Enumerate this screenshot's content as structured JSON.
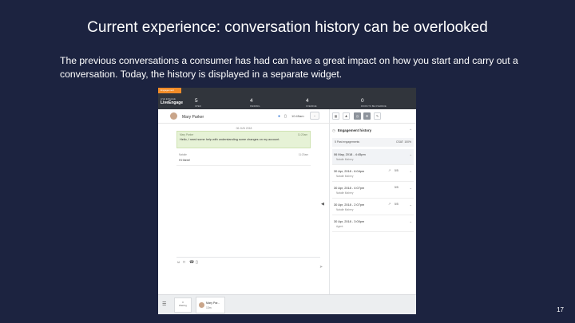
{
  "slide": {
    "title": "Current experience: conversation history can be overlooked",
    "body": "The previous conversations a consumer has had can have a great impact on how you start and carry out a conversation. Today, the history is displayed in a separate widget.",
    "page_number": "17"
  },
  "app": {
    "top_tab": "Engagement",
    "logo_sub": "LIVE ENGAGE",
    "logo_name": "LiveEngage",
    "stats": [
      {
        "num": "5",
        "label": "OPEN"
      },
      {
        "num": "4",
        "label": "PENDING"
      },
      {
        "num": "4",
        "label": "OVERDUE"
      },
      {
        "num": "0",
        "label": "ROOM TO BE OVERDUE"
      }
    ]
  },
  "chat": {
    "contact_name": "Mary Parker",
    "header_time": "10:45am",
    "date_separator": "06 JUN 2018",
    "messages": [
      {
        "sender": "Mary Parker",
        "time": "11:20am",
        "text": "Hello, I need some help with understanding some changes on my account.",
        "type": "consumer"
      },
      {
        "sender": "Natalie",
        "time": "11:20am",
        "text": "Hi there!",
        "type": "agent"
      }
    ]
  },
  "bottom": {
    "waiting_label": "Waiting",
    "waiting_count": "0",
    "active_name": "Mary Par...",
    "active_time": "13m"
  },
  "widget": {
    "title": "Engagement history",
    "summary_left": "5 Past engagements",
    "summary_right": "CSAT: 100%",
    "engagements": [
      {
        "date": "06 May, 2018 - 4:45pm",
        "agent": "Natalie Mahery",
        "score": "",
        "highlight": true
      },
      {
        "date": "30 Apr, 2018 - 6:04pm",
        "agent": "Natalie Mahery",
        "score": "5/5",
        "highlight": false
      },
      {
        "date": "30 Apr, 2018 - 4:07pm",
        "agent": "Natalie Mahery",
        "score": "5/5",
        "highlight": false
      },
      {
        "date": "30 Apr, 2018 - 2:07pm",
        "agent": "Natalie Mahery",
        "score": "5/5",
        "highlight": false
      },
      {
        "date": "30 Apr, 2018 - 3:00pm",
        "agent": "Agent",
        "score": "",
        "highlight": false
      }
    ]
  }
}
